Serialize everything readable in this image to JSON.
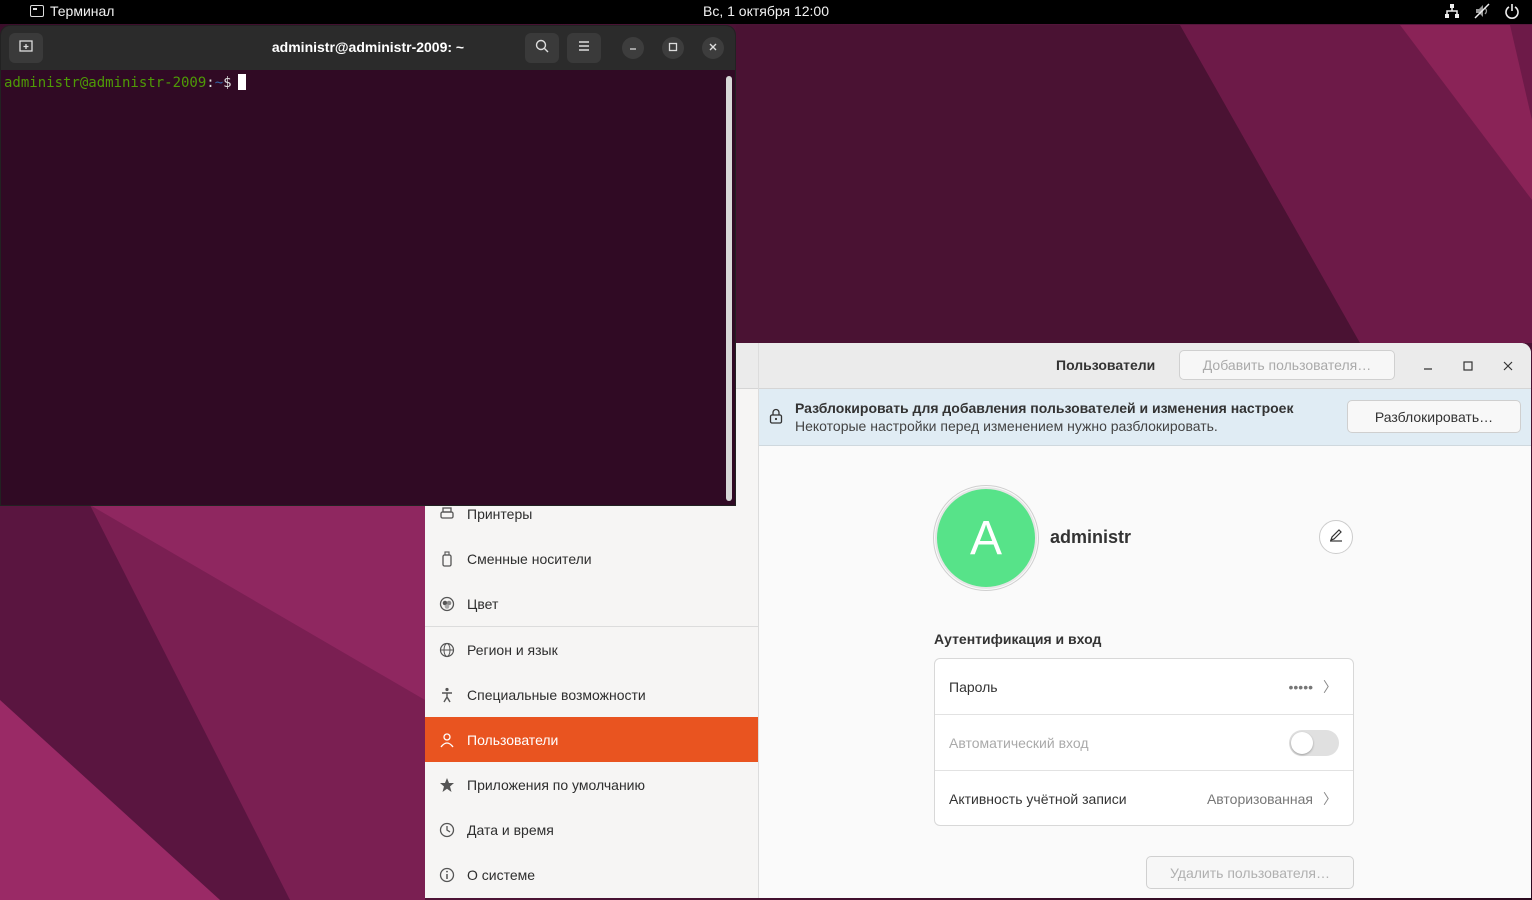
{
  "topbar": {
    "app_name": "Терминал",
    "clock": "Вс, 1 октября  12:00",
    "tray_icons": [
      "network-icon",
      "volume-muted-icon",
      "power-icon"
    ]
  },
  "terminal": {
    "title": "administr@administr-2009: ~",
    "prompt_user": "administr@administr-2009",
    "prompt_colon": ":",
    "prompt_path": "~",
    "prompt_dollar": "$"
  },
  "settings": {
    "header_title": "Пользователи",
    "add_user_label": "Добавить пользователя…",
    "infobar": {
      "title": "Разблокировать для добавления пользователей и изменения настроек",
      "subtitle": "Некоторые настройки перед изменением нужно разблокировать.",
      "unlock_label": "Разблокировать…"
    },
    "sidebar": {
      "items": [
        {
          "label": "Принтеры",
          "icon": "printer-icon"
        },
        {
          "label": "Сменные носители",
          "icon": "removable-media-icon"
        },
        {
          "label": "Цвет",
          "icon": "color-icon"
        },
        {
          "label": "Регион и язык",
          "icon": "globe-icon"
        },
        {
          "label": "Специальные возможности",
          "icon": "accessibility-icon"
        },
        {
          "label": "Пользователи",
          "icon": "users-icon",
          "active": true
        },
        {
          "label": "Приложения по умолчанию",
          "icon": "star-icon"
        },
        {
          "label": "Дата и время",
          "icon": "clock-icon"
        },
        {
          "label": "О системе",
          "icon": "info-icon"
        }
      ]
    },
    "user": {
      "avatar_letter": "A",
      "avatar_color": "#57e389",
      "name": "administr"
    },
    "auth": {
      "section_title": "Аутентификация и вход",
      "password_label": "Пароль",
      "password_value": "•••••",
      "autologin_label": "Автоматический вход",
      "autologin_enabled": false,
      "activity_label": "Активность учётной записи",
      "activity_value": "Авторизованная"
    },
    "delete_label": "Удалить пользователя…",
    "accent_color": "#e95420"
  }
}
